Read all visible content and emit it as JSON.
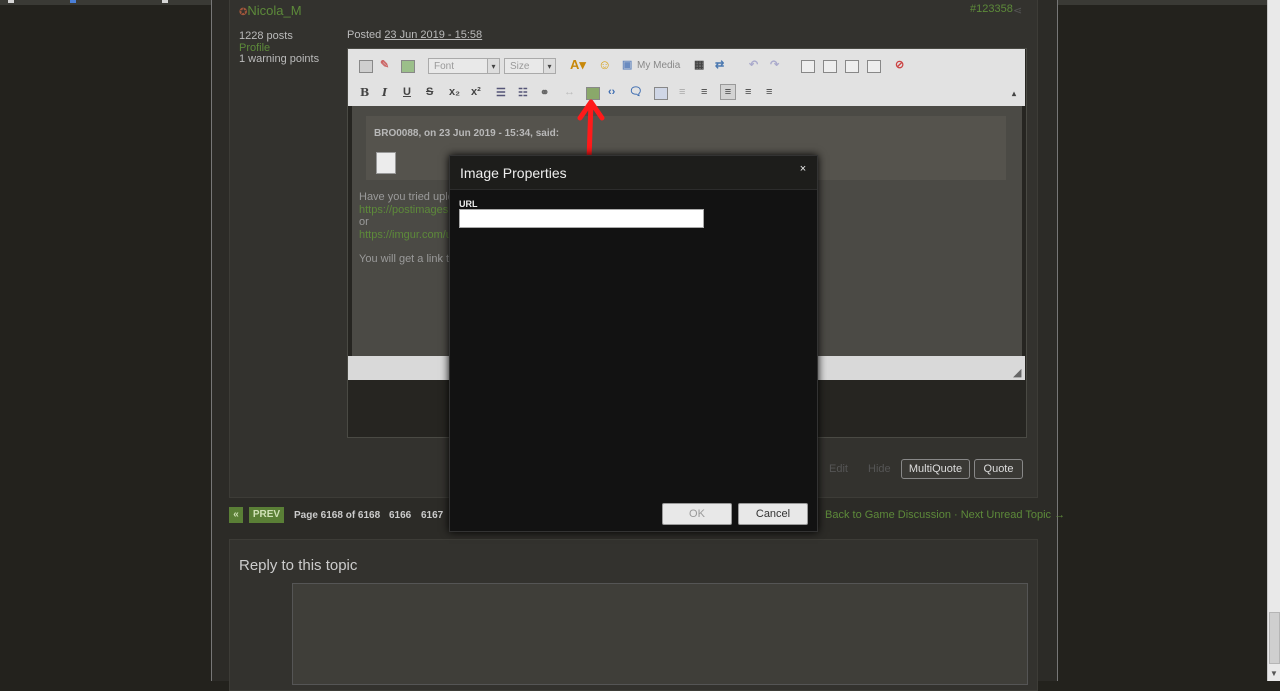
{
  "post": {
    "author": "Nicola_M",
    "post_id": "#123358",
    "posts_count": "1228 posts",
    "profile_link": "Profile",
    "warning_points": "1 warning points",
    "posted_prefix": "Posted",
    "posted_date": "23 Jun 2019 - 15:58"
  },
  "editor": {
    "font_placeholder": "Font",
    "size_placeholder": "Size",
    "my_media": "My Media",
    "quote_header": "BRO0088, on 23 Jun 2019 - 15:34, said:",
    "body_lines": [
      "Have you tried uplo",
      "https://postimages.",
      "or",
      "https://imgur.com/up",
      "You will get a link th"
    ]
  },
  "post_actions": {
    "edit": "Edit",
    "hide": "Hide",
    "multiquote": "MultiQuote",
    "quote": "Quote"
  },
  "pagination": {
    "first": "«",
    "prev": "PREV",
    "page_info": "Page 6168 of 6168",
    "page_a": "6166",
    "page_b": "6167",
    "back_link": "Back to Game Discussion",
    "separator": "·",
    "next_unread": "Next Unread Topic →"
  },
  "reply": {
    "title": "Reply to this topic"
  },
  "modal": {
    "title": "Image Properties",
    "close": "×",
    "url_label": "URL",
    "url_value": "",
    "ok": "OK",
    "cancel": "Cancel"
  },
  "colors": {
    "annotation_arrow": "#ff1a1a",
    "link_green": "#5d8a3a"
  }
}
